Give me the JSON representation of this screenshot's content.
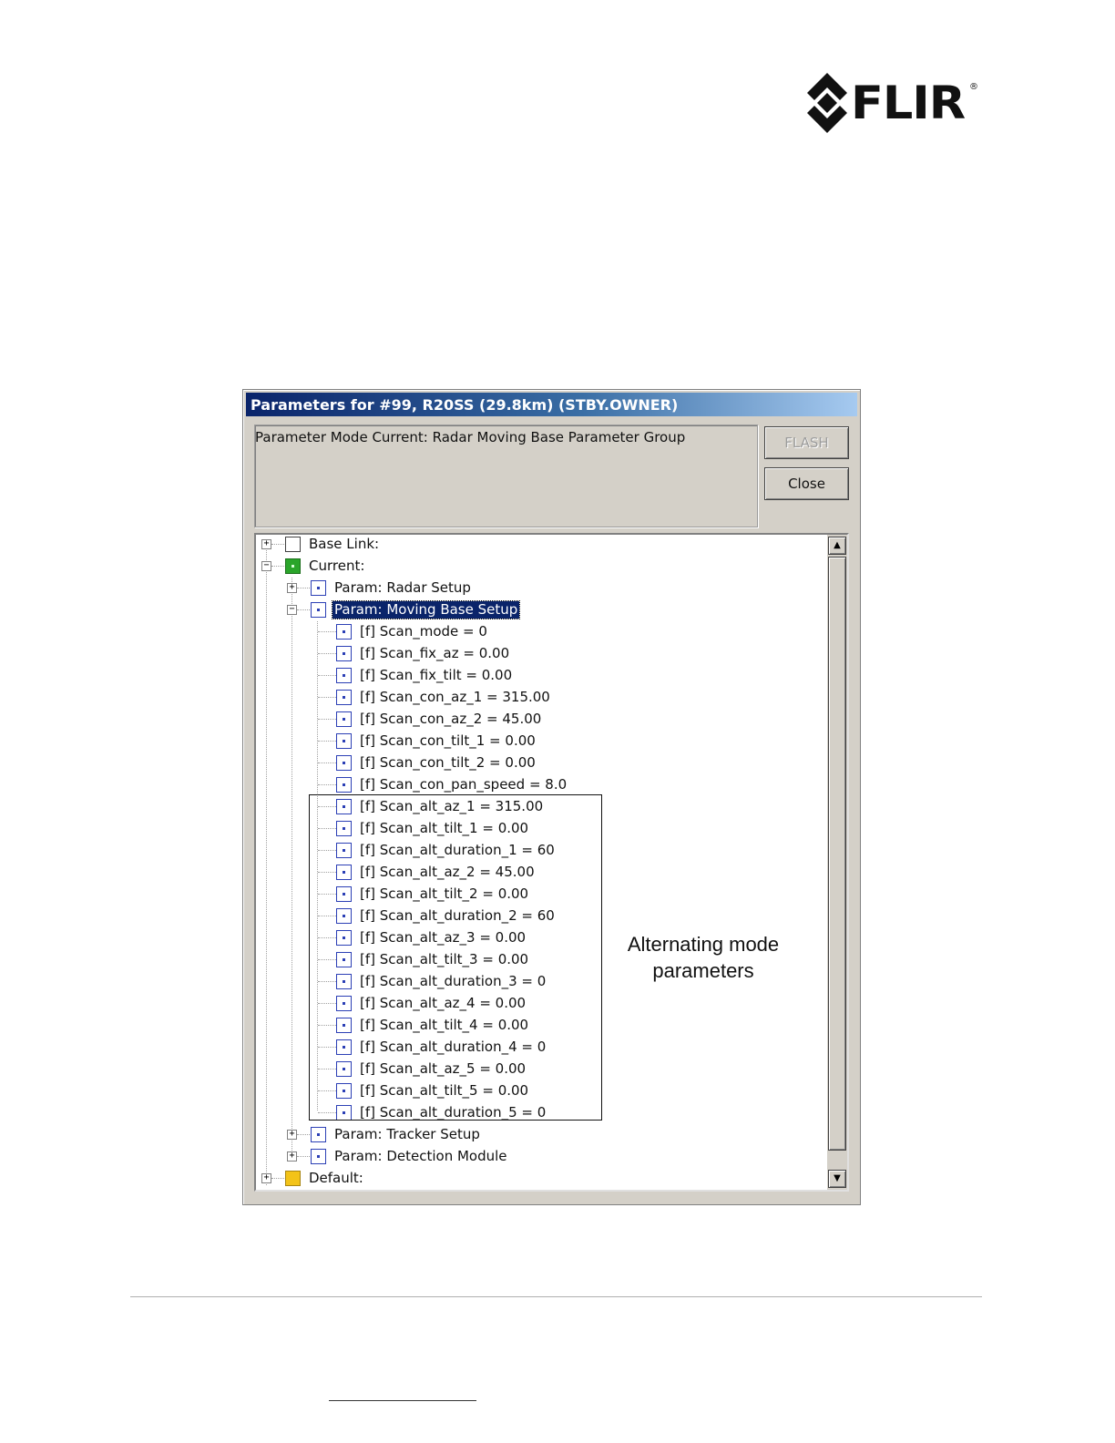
{
  "brand": {
    "logo_text": "FLIR",
    "registered": "®"
  },
  "dialog": {
    "title": "Parameters for #99, R20SS (29.8km) (STBY.OWNER)",
    "info_text": "Parameter Mode Current: Radar Moving Base Parameter Group",
    "buttons": {
      "flash": "FLASH",
      "close": "Close"
    }
  },
  "tree": {
    "base_link": "Base Link:",
    "current": "Current:",
    "radar_setup": "Param: Radar Setup",
    "moving_base_setup": "Param: Moving Base Setup",
    "params": [
      "[f] Scan_mode = 0",
      "[f] Scan_fix_az = 0.00",
      "[f] Scan_fix_tilt = 0.00",
      "[f] Scan_con_az_1 = 315.00",
      "[f] Scan_con_az_2 = 45.00",
      "[f] Scan_con_tilt_1 = 0.00",
      "[f] Scan_con_tilt_2 = 0.00",
      "[f] Scan_con_pan_speed = 8.0",
      "[f] Scan_alt_az_1 = 315.00",
      "[f] Scan_alt_tilt_1 = 0.00",
      "[f] Scan_alt_duration_1 = 60",
      "[f] Scan_alt_az_2 = 45.00",
      "[f] Scan_alt_tilt_2 = 0.00",
      "[f] Scan_alt_duration_2 = 60",
      "[f] Scan_alt_az_3 = 0.00",
      "[f] Scan_alt_tilt_3 = 0.00",
      "[f] Scan_alt_duration_3 = 0",
      "[f] Scan_alt_az_4 = 0.00",
      "[f] Scan_alt_tilt_4 = 0.00",
      "[f] Scan_alt_duration_4 = 0",
      "[f] Scan_alt_az_5 = 0.00",
      "[f] Scan_alt_tilt_5 = 0.00",
      "[f] Scan_alt_duration_5 = 0"
    ],
    "tracker_setup": "Param: Tracker Setup",
    "detection_module": "Param: Detection Module",
    "default": "Default:"
  },
  "annotation": {
    "line1": "Alternating mode",
    "line2": "parameters"
  },
  "colors": {
    "selection": "#0a246a",
    "icon_blue": "#2b3fb5",
    "current_green": "#2aa52a",
    "default_yellow": "#f3c318"
  }
}
